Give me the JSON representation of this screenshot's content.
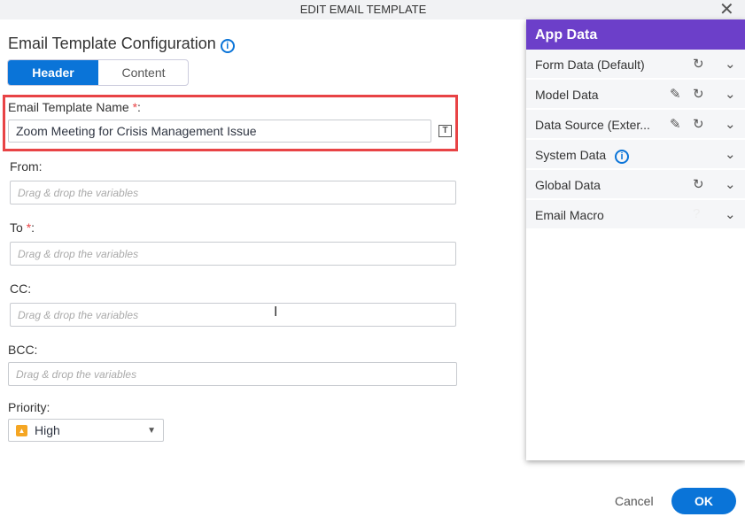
{
  "dialog": {
    "title": "EDIT EMAIL TEMPLATE"
  },
  "heading": "Email Template Configuration",
  "tabs": [
    {
      "label": "Header",
      "active": true
    },
    {
      "label": "Content",
      "active": false
    }
  ],
  "fields": {
    "name": {
      "label": "Email Template Name ",
      "required": "*",
      "value": "Zoom Meeting for Crisis Management Issue"
    },
    "from": {
      "label": "From:",
      "placeholder": "Drag & drop the variables"
    },
    "to": {
      "label": "To ",
      "required": "*",
      "placeholder": "Drag & drop the variables"
    },
    "cc": {
      "label": "CC:",
      "placeholder": "Drag & drop the variables"
    },
    "bcc": {
      "label": "BCC:",
      "placeholder": "Drag & drop the variables"
    },
    "priority": {
      "label": "Priority:",
      "value": "High",
      "color": "#f5a623"
    }
  },
  "app_data": {
    "title": "App Data",
    "color": "#6c3fc9",
    "items": [
      {
        "label": "Form Data (Default)"
      },
      {
        "label": "Model Data"
      },
      {
        "label": "Data Source (Exter..."
      },
      {
        "label": "System Data"
      },
      {
        "label": "Global Data"
      },
      {
        "label": "Email Macro"
      }
    ]
  },
  "footer": {
    "cancel": "Cancel",
    "ok": "OK"
  }
}
